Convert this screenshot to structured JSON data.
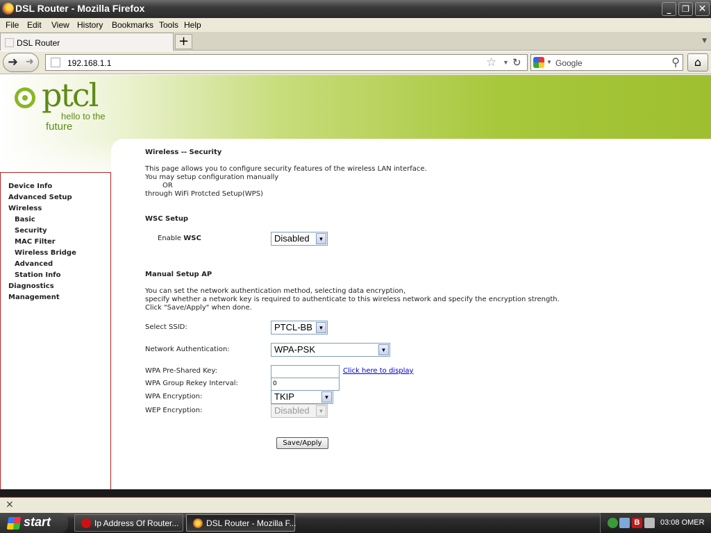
{
  "window": {
    "title": "DSL Router - Mozilla Firefox",
    "controls": {
      "minimize": "_",
      "restore": "❐",
      "close": "✕"
    }
  },
  "menu": [
    "File",
    "Edit",
    "View",
    "History",
    "Bookmarks",
    "Tools",
    "Help"
  ],
  "tabs": [
    {
      "label": "DSL Router"
    }
  ],
  "tab_new": "+",
  "nav": {
    "url": "192.168.1.1",
    "search_engine": "Google",
    "search_placeholder": "Google"
  },
  "logo": {
    "word": "ptcl",
    "tag_line1": "hello to the",
    "tag_line2": "future"
  },
  "sidebar": {
    "items": [
      {
        "label": "Device Info",
        "level": 0
      },
      {
        "label": "Advanced Setup",
        "level": 0
      },
      {
        "label": "Wireless",
        "level": 0
      },
      {
        "label": "Basic",
        "level": 1
      },
      {
        "label": "Security",
        "level": 1
      },
      {
        "label": "MAC Filter",
        "level": 1
      },
      {
        "label": "Wireless Bridge",
        "level": 1
      },
      {
        "label": "Advanced",
        "level": 1
      },
      {
        "label": "Station Info",
        "level": 1
      },
      {
        "label": "Diagnostics",
        "level": 0
      },
      {
        "label": "Management",
        "level": 0
      }
    ]
  },
  "page": {
    "heading": "Wireless -- Security",
    "intro": [
      "This page allows you to configure security features of the wireless LAN interface.",
      "You may setup configuration manually",
      "OR",
      "through WiFi Protcted Setup(WPS)"
    ],
    "wsc": {
      "heading": "WSC Setup",
      "enable_label_prefix": "Enable ",
      "enable_label_bold": "WSC",
      "enable_value": "Disabled"
    },
    "manual": {
      "heading": "Manual Setup AP",
      "desc": [
        "You can set the network authentication method, selecting data encryption,",
        "specify whether a network key is required to authenticate to this wireless network and specify the encryption strength.",
        "Click \"Save/Apply\" when done."
      ],
      "ssid_label": "Select SSID:",
      "ssid_value": "PTCL-BB",
      "auth_label": "Network Authentication:",
      "auth_value": "WPA-PSK",
      "psk_label": "WPA Pre-Shared Key:",
      "psk_value": "",
      "psk_link": "Click here to display",
      "rekey_label": "WPA Group Rekey Interval:",
      "rekey_value": "0",
      "wpa_enc_label": "WPA Encryption:",
      "wpa_enc_value": "TKIP",
      "wep_enc_label": "WEP Encryption:",
      "wep_enc_value": "Disabled",
      "save_button": "Save/Apply"
    }
  },
  "findbar": {
    "close": "×"
  },
  "taskbar": {
    "start": "start",
    "tasks": [
      {
        "label": "Ip Address Of Router...",
        "active": false,
        "icon_color": "#d01010"
      },
      {
        "label": "DSL Router - Mozilla F...",
        "active": true,
        "icon_color": "#e8761c"
      }
    ],
    "clock": "03:08 OMER"
  }
}
